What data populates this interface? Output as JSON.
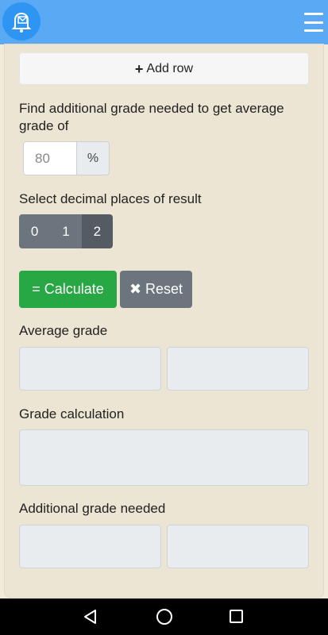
{
  "app": {
    "icon": "bell-envelope-icon",
    "menu_icon": "hamburger-menu-icon",
    "header_color": "#5aa9f5"
  },
  "form": {
    "add_row_label": "Add row",
    "target_label": "Find additional grade needed to get average grade of",
    "target_value": "80",
    "target_unit": "%",
    "decimal_label": "Select decimal places of result",
    "decimal_options": [
      "0",
      "1",
      "2"
    ],
    "decimal_selected": "2",
    "calculate_label": "= Calculate",
    "reset_label": "✖ Reset"
  },
  "results": {
    "average_grade_label": "Average grade",
    "grade_calculation_label": "Grade calculation",
    "additional_grade_label": "Additional grade needed"
  },
  "colors": {
    "calculate": "#28a745",
    "secondary": "#6c757d",
    "panel": "#ece5d4"
  }
}
